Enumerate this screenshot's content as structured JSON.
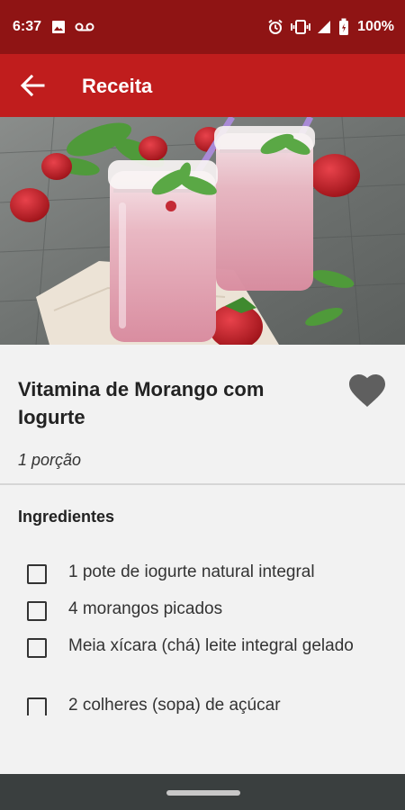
{
  "status_bar": {
    "time": "6:37",
    "battery": "100%",
    "icons": [
      "image-icon",
      "voicemail-icon",
      "alarm-icon",
      "vibrate-icon",
      "signal-icon",
      "battery-icon"
    ]
  },
  "app_bar": {
    "title": "Receita",
    "back_icon": "arrow-left-icon"
  },
  "recipe": {
    "title": "Vitamina de Morango com Iogurte",
    "portion": "1 porção",
    "favorite_icon": "heart-icon"
  },
  "ingredients": {
    "heading": "Ingredientes",
    "items": [
      {
        "text": "1 pote de iogurte natural integral",
        "checked": false
      },
      {
        "text": "4 morangos picados",
        "checked": false
      },
      {
        "text": "Meia xícara (chá) leite integral gelado",
        "checked": false
      },
      {
        "text": "2 colheres (sopa) de açúcar",
        "checked": false
      }
    ]
  },
  "colors": {
    "status_bar": "#8f1414",
    "app_bar": "#c01d1d",
    "background": "#f2f2f2",
    "nav_bar": "#3a3f3f"
  }
}
